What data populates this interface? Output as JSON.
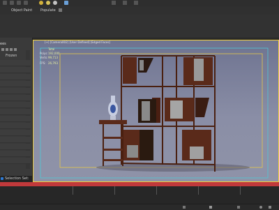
{
  "toolbar": {
    "object_paint": "Object Paint",
    "populate": "Populate"
  },
  "scene_explorer": {
    "title": "ees",
    "filter_label": "Frozen"
  },
  "viewport": {
    "label": "[+] [Camera002] [User Defined] [Edged Faces]",
    "stats": [
      {
        "key": "",
        "value": "Total"
      },
      {
        "key": "Polys:",
        "value": "192,000"
      },
      {
        "key": "Verts:",
        "value": "99,713"
      },
      {
        "key": "FPS:",
        "value": "26,793"
      }
    ]
  },
  "selection_set": {
    "label": "Selection Set:"
  },
  "colors": {
    "viewport_border": "#f0d040",
    "safe_frame_outer": "#4ec9d6",
    "safe_frame_inner": "#e6c84a",
    "timeline": "#c0393b",
    "wood": "#5a2a1a"
  },
  "icons": [
    "play-icon",
    "stop-icon",
    "key-icon",
    "select-icon",
    "move-icon",
    "rotate-icon",
    "scale-icon"
  ]
}
